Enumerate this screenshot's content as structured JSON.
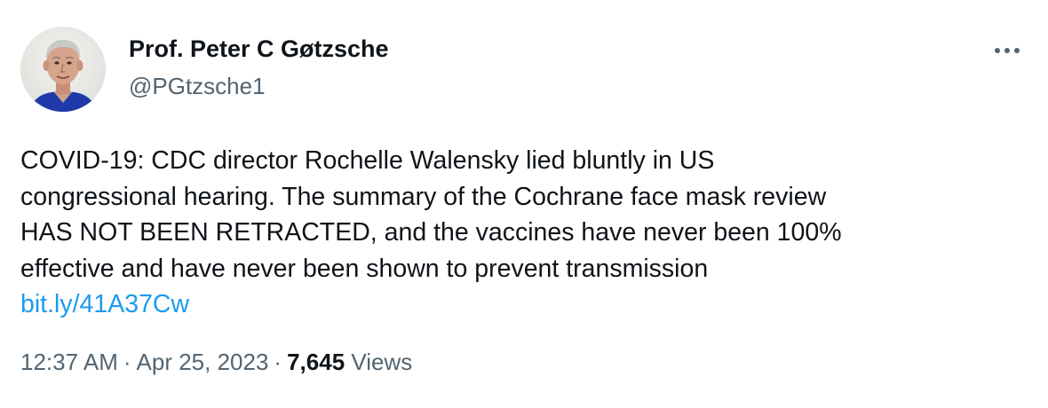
{
  "author": {
    "display_name": "Prof. Peter C Gøtzsche",
    "handle": "@PGtzsche1",
    "avatar_icon": "profile-photo"
  },
  "more_icon": "ellipsis-icon",
  "tweet": {
    "text_lines": [
      "COVID-19: CDC director Rochelle Walensky lied bluntly in US",
      "congressional hearing. The summary of the Cochrane face mask review",
      "HAS NOT BEEN RETRACTED, and the vaccines have never been 100%",
      "effective and have never been shown to prevent transmission"
    ],
    "link": "bit.ly/41A37Cw"
  },
  "meta": {
    "time": "12:37 AM",
    "separator": "·",
    "date": "Apr 25, 2023",
    "views_count": "7,645",
    "views_label": "Views"
  },
  "colors": {
    "text": "#0f1419",
    "secondary": "#536471",
    "link": "#1d9bf0"
  }
}
